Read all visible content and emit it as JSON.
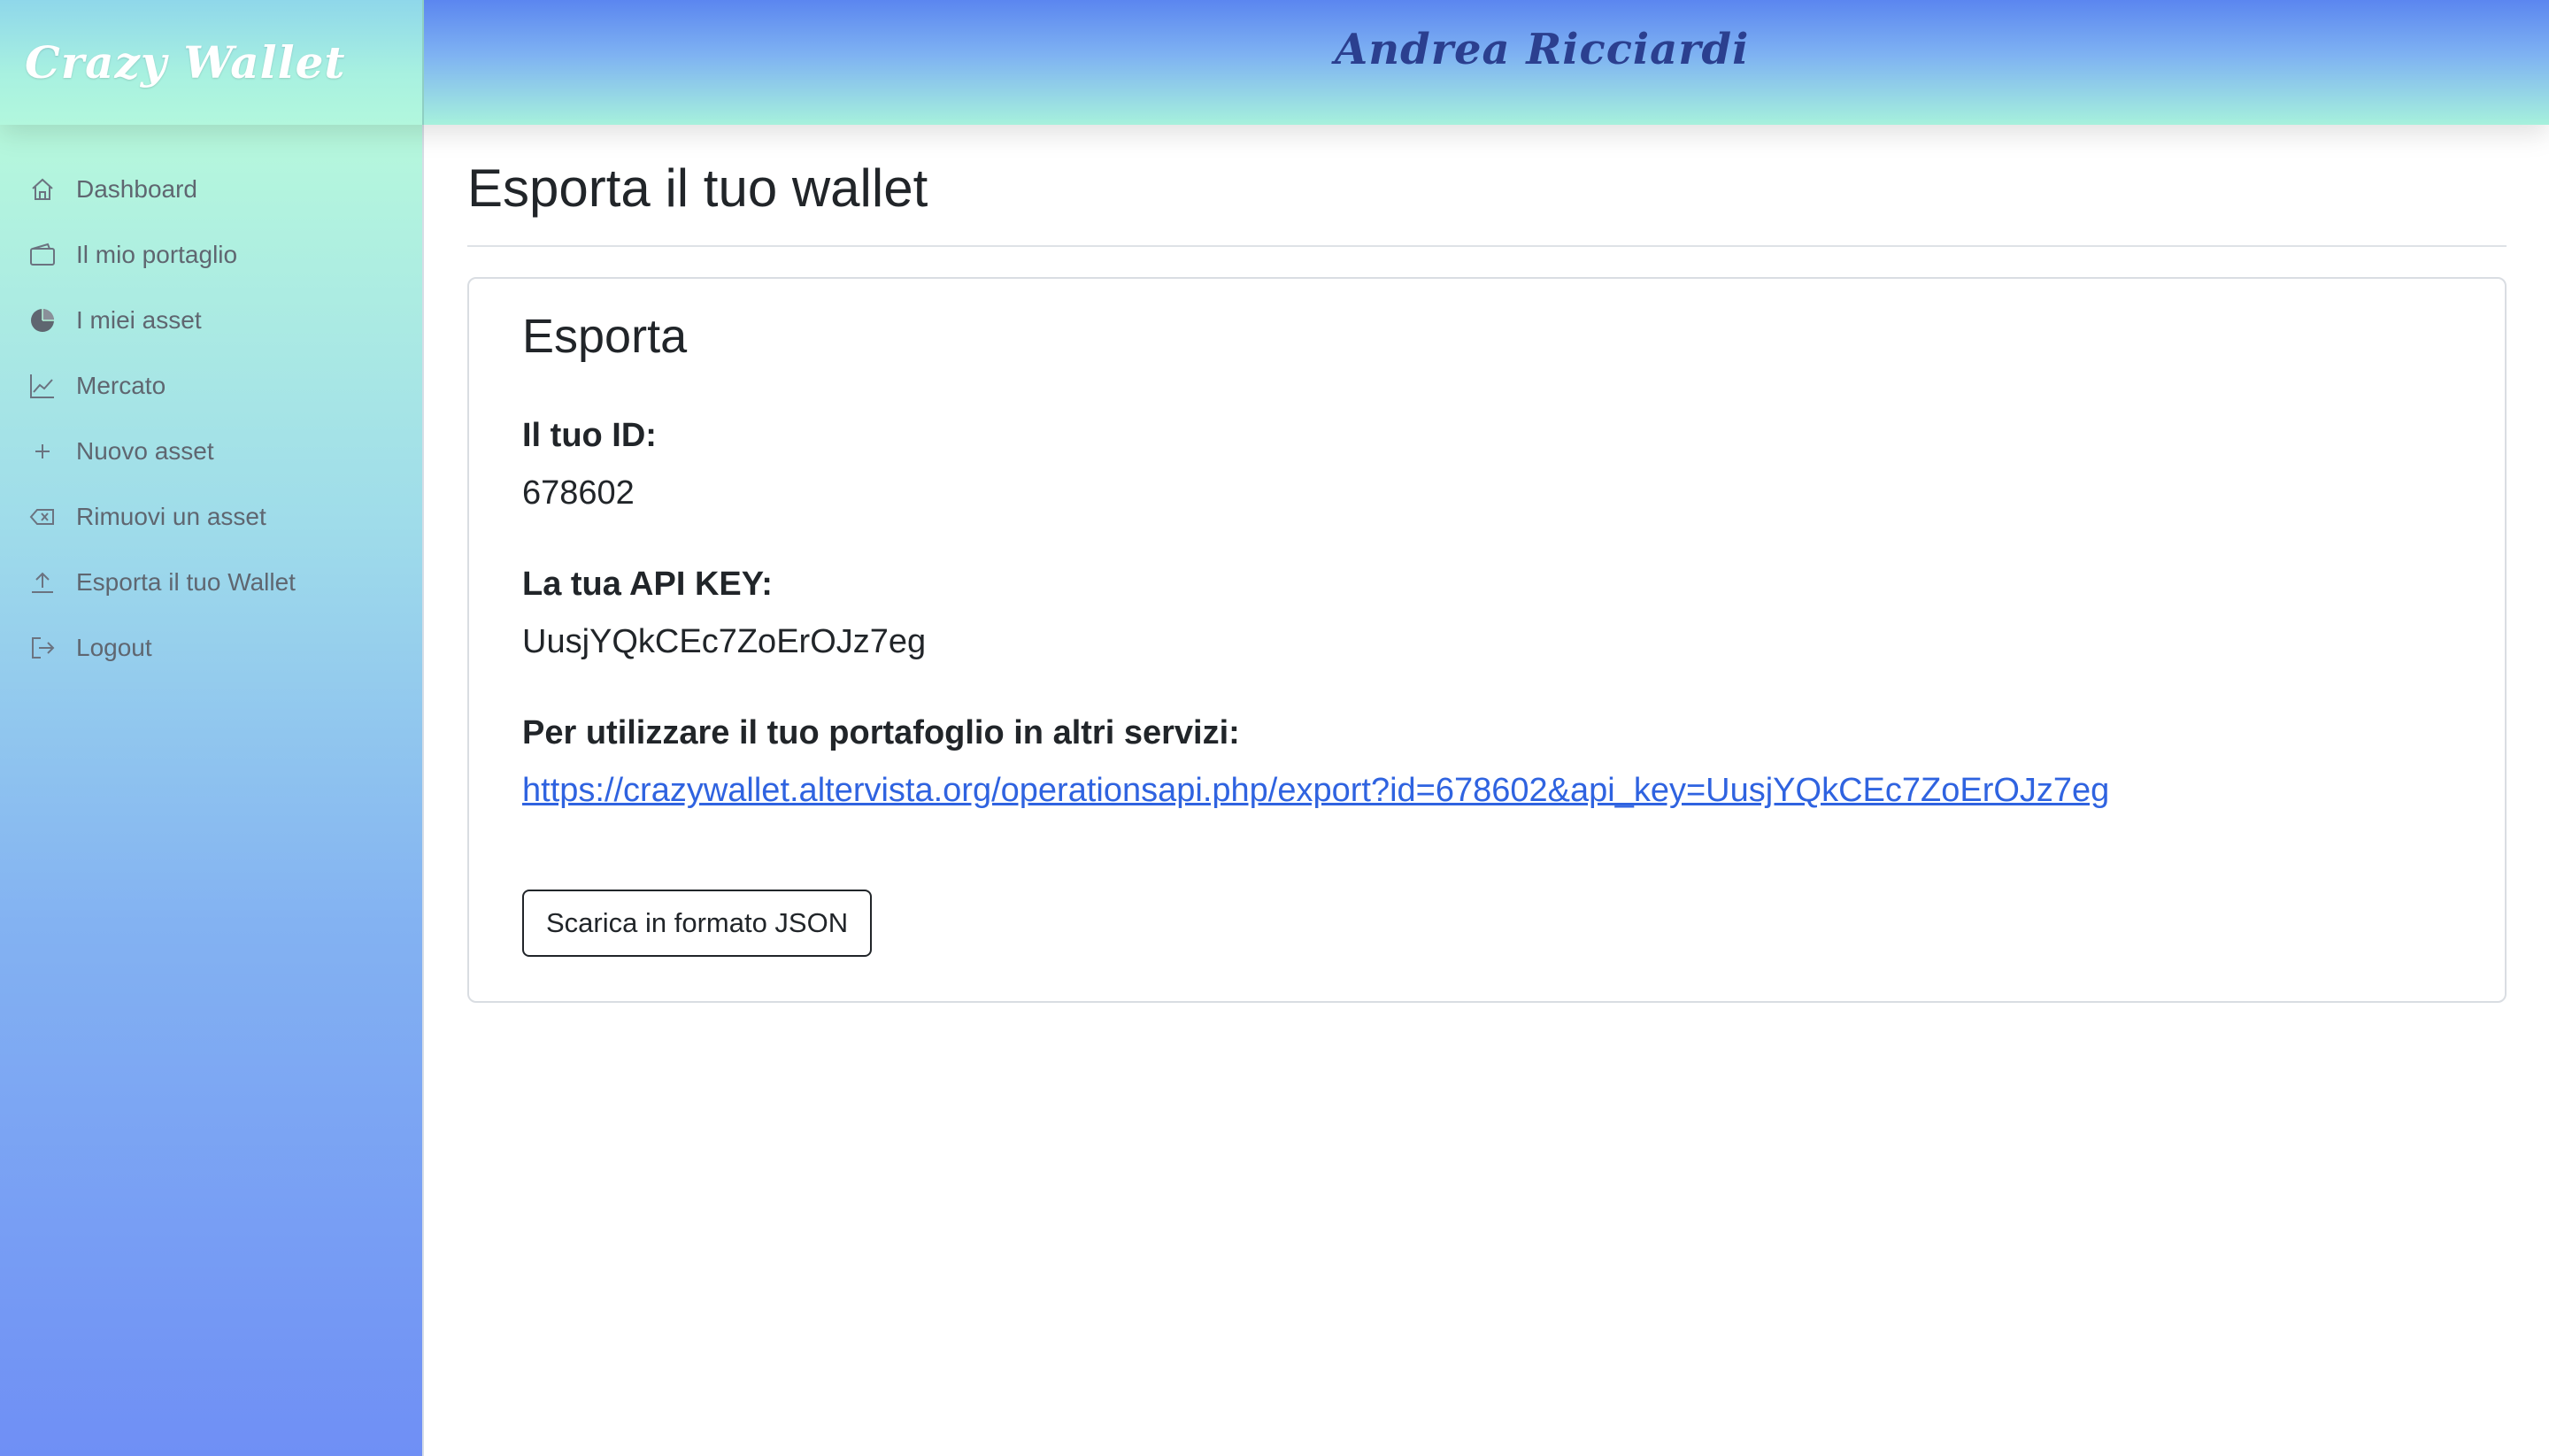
{
  "header": {
    "brand": "Crazy Wallet",
    "user_name": "Andrea Ricciardi"
  },
  "sidebar": {
    "items": [
      {
        "label": "Dashboard",
        "icon": "house-icon"
      },
      {
        "label": "Il mio portaglio",
        "icon": "wallet-icon"
      },
      {
        "label": "I miei asset",
        "icon": "pie-chart-icon"
      },
      {
        "label": "Mercato",
        "icon": "line-chart-icon"
      },
      {
        "label": "Nuovo asset",
        "icon": "plus-icon"
      },
      {
        "label": "Rimuovi un asset",
        "icon": "backspace-icon"
      },
      {
        "label": "Esporta il tuo Wallet",
        "icon": "upload-icon"
      },
      {
        "label": "Logout",
        "icon": "logout-icon"
      }
    ]
  },
  "main": {
    "title": "Esporta il tuo wallet",
    "card": {
      "title": "Esporta",
      "id_label": "Il tuo ID:",
      "id_value": "678602",
      "api_label": "La tua API KEY:",
      "api_value": "UusjYQkCEc7ZoErOJz7eg",
      "usage_label": "Per utilizzare il tuo portafoglio in altri servizi:",
      "usage_url": "https://crazywallet.altervista.org/operationsapi.php/export?id=678602&api_key=UusjYQkCEc7ZoErOJz7eg",
      "download_button": "Scarica in formato JSON"
    }
  },
  "colors": {
    "link": "#2f63e0",
    "header_blue": "#5b86f0",
    "mint": "#b2f7dd",
    "user_name": "#2b3f8f"
  }
}
